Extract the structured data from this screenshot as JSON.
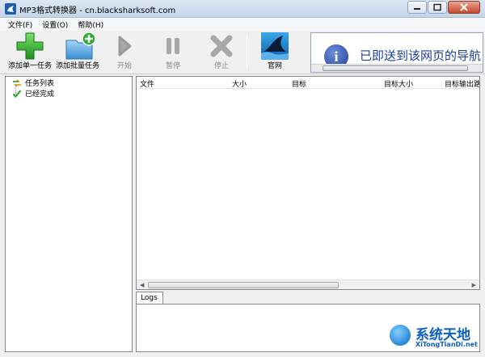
{
  "window": {
    "title": "MP3格式转换器 - cn.blacksharksoft.com"
  },
  "menu": [
    {
      "label": "文件(F)"
    },
    {
      "label": "设置(O)"
    },
    {
      "label": "帮助(H)"
    }
  ],
  "toolbar": {
    "add_single": "添加单一任务",
    "add_batch": "添加批量任务",
    "start": "开始",
    "pause": "暂停",
    "stop": "停止",
    "website": "官网"
  },
  "ad": {
    "text": "已即送到该网页的导航"
  },
  "tree": {
    "task_list": "任务列表",
    "completed": "已经完成"
  },
  "list": {
    "columns": [
      "文件",
      "大小",
      "目标",
      "目标大小",
      "目标输出路"
    ]
  },
  "logs": {
    "tab_label": "Logs"
  },
  "watermark": {
    "title": "系统天地",
    "url": "XiTongTianDi.net"
  },
  "colors": {
    "accent": "#1a3f9b",
    "add_green": "#2eaa2e",
    "disabled_gray": "#a0a0a0"
  }
}
